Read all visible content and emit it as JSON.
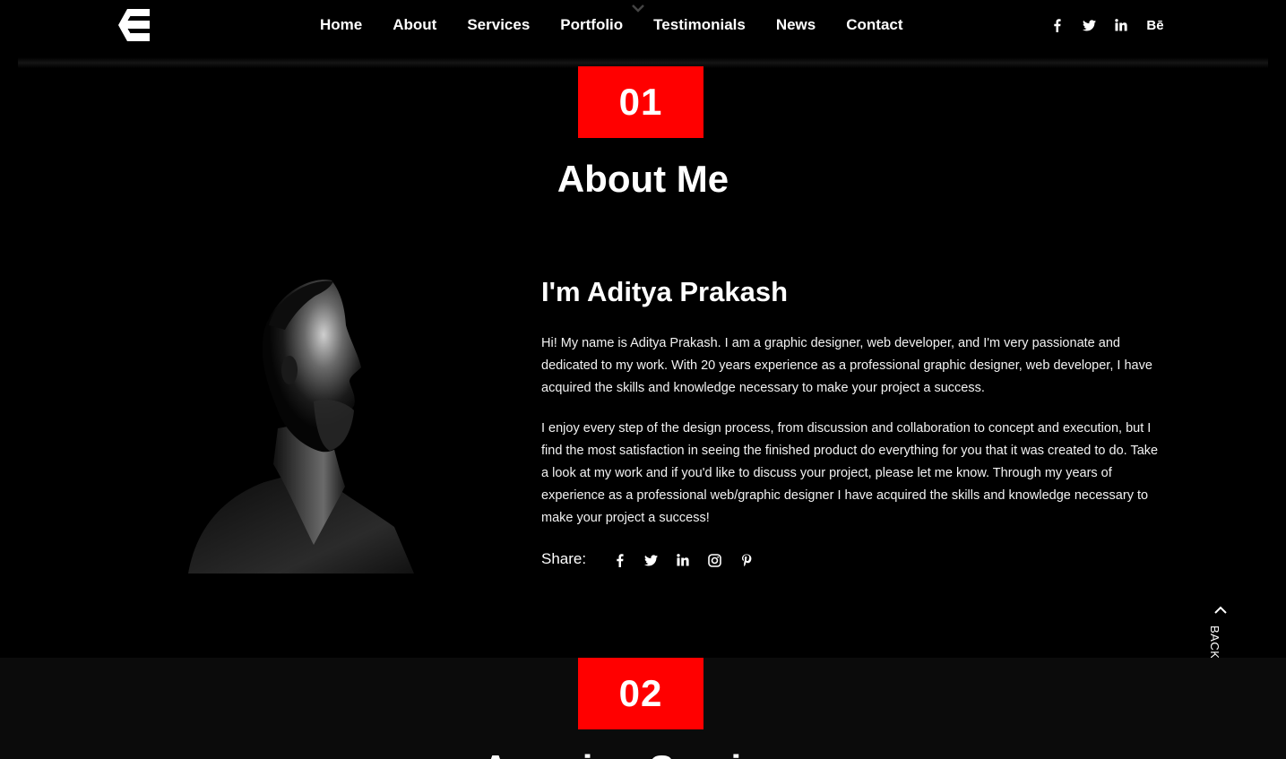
{
  "header": {
    "nav": [
      "Home",
      "About",
      "Services",
      "Portfolio",
      "Testimonials",
      "News",
      "Contact"
    ],
    "social": [
      "facebook-icon",
      "twitter-icon",
      "linkedin-icon",
      "behance-icon"
    ],
    "behance_label": "Bē"
  },
  "about": {
    "number": "01",
    "title": "About Me",
    "name": "I'm Aditya Prakash",
    "paragraph1": "Hi! My name is Aditya Prakash. I am a graphic designer, web developer, and I'm very passionate and dedicated to my work. With 20 years experience as a professional graphic designer, web developer, I have acquired the skills and knowledge necessary to make your project a success.",
    "paragraph2": "I enjoy every step of the design process, from discussion and collaboration to concept and execution, but I find the most satisfaction in seeing the finished product do everything for you that it was created to do. Take a look at my work and if you'd like to discuss your project, please let me know. Through my years of experience as a professional web/graphic designer I have acquired the skills and knowledge necessary to make your project a success!",
    "share_label": "Share:",
    "share_icons": [
      "facebook-icon",
      "twitter-icon",
      "linkedin-icon",
      "instagram-icon",
      "pinterest-icon"
    ]
  },
  "back_to_top": "BACK TO TOP",
  "services": {
    "number": "02",
    "title": "Amazing Services"
  },
  "colors": {
    "accent": "#ff0000",
    "background": "#000000",
    "section2_background": "#0b0b0b"
  }
}
